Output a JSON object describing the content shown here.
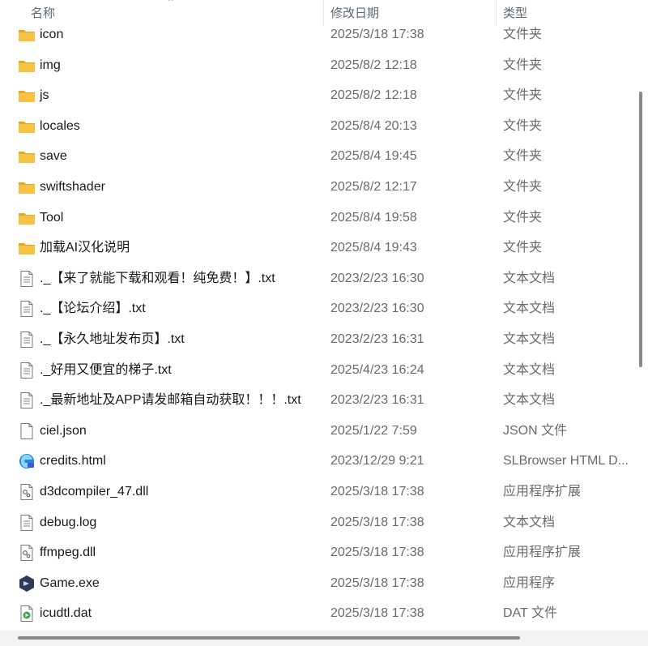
{
  "columns": {
    "name": "名称",
    "date": "修改日期",
    "type": "类型"
  },
  "sort_indicator": "^",
  "files": [
    {
      "icon": "folder-icon",
      "name": "icon",
      "date": "2025/3/18 17:38",
      "type": "文件夹"
    },
    {
      "icon": "folder-icon",
      "name": "img",
      "date": "2025/8/2 12:18",
      "type": "文件夹"
    },
    {
      "icon": "folder-icon",
      "name": "js",
      "date": "2025/8/2 12:18",
      "type": "文件夹"
    },
    {
      "icon": "folder-icon",
      "name": "locales",
      "date": "2025/8/4 20:13",
      "type": "文件夹"
    },
    {
      "icon": "folder-icon",
      "name": "save",
      "date": "2025/8/4 19:45",
      "type": "文件夹"
    },
    {
      "icon": "folder-icon",
      "name": "swiftshader",
      "date": "2025/8/2 12:17",
      "type": "文件夹"
    },
    {
      "icon": "folder-icon",
      "name": "Tool",
      "date": "2025/8/4 19:58",
      "type": "文件夹"
    },
    {
      "icon": "folder-icon",
      "name": "加载AI汉化说明",
      "date": "2025/8/4 19:43",
      "type": "文件夹"
    },
    {
      "icon": "text-document-icon",
      "name": "._【来了就能下载和观看！纯免费！】.txt",
      "date": "2023/2/23 16:30",
      "type": "文本文档"
    },
    {
      "icon": "text-document-icon",
      "name": "._【论坛介绍】.txt",
      "date": "2023/2/23 16:30",
      "type": "文本文档"
    },
    {
      "icon": "text-document-icon",
      "name": "._【永久地址发布页】.txt",
      "date": "2023/2/23 16:31",
      "type": "文本文档"
    },
    {
      "icon": "text-document-icon",
      "name": "._好用又便宜的梯子.txt",
      "date": "2025/4/23 16:24",
      "type": "文本文档"
    },
    {
      "icon": "text-document-icon",
      "name": "._最新地址及APP请发邮箱自动获取！！！.txt",
      "date": "2023/2/23 16:31",
      "type": "文本文档"
    },
    {
      "icon": "blank-file-icon",
      "name": "ciel.json",
      "date": "2025/1/22 7:59",
      "type": "JSON 文件"
    },
    {
      "icon": "browser-html-icon",
      "name": "credits.html",
      "date": "2023/12/29 9:21",
      "type": "SLBrowser HTML D..."
    },
    {
      "icon": "dll-extension-icon",
      "name": "d3dcompiler_47.dll",
      "date": "2025/3/18 17:38",
      "type": "应用程序扩展"
    },
    {
      "icon": "text-document-icon",
      "name": "debug.log",
      "date": "2025/3/18 17:38",
      "type": "文本文档"
    },
    {
      "icon": "dll-extension-icon",
      "name": "ffmpeg.dll",
      "date": "2025/3/18 17:38",
      "type": "应用程序扩展"
    },
    {
      "icon": "game-exe-icon",
      "name": "Game.exe",
      "date": "2025/3/18 17:38",
      "type": "应用程序"
    },
    {
      "icon": "media-file-icon",
      "name": "icudtl.dat",
      "date": "2025/3/18 17:38",
      "type": "DAT 文件"
    }
  ],
  "colors": {
    "folder": "#f6c344",
    "folder_dark": "#e8a820",
    "browser_accent": "#1e88e5",
    "game_icon": "#2b3a55"
  }
}
